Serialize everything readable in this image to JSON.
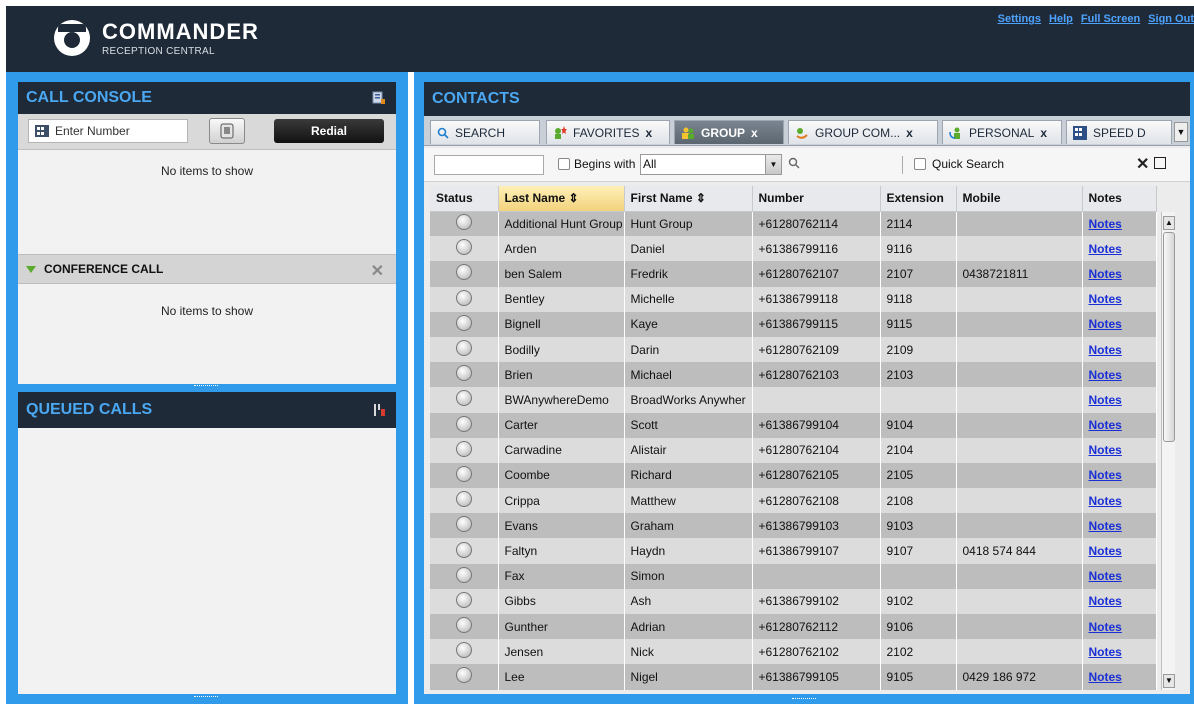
{
  "app": {
    "brand": "COΜΜANDER",
    "subtitle": "RECEPTION CENTRAL"
  },
  "toplinks": [
    "Settings",
    "Help",
    "Full Screen",
    "Sign Out"
  ],
  "call_console": {
    "title": "CALL CONSOLE",
    "number_placeholder": "Enter Number",
    "redial_label": "Redial",
    "empty_text": "No items to show",
    "conference_title": "CONFERENCE CALL",
    "conference_empty_text": "No items to show"
  },
  "queued_calls": {
    "title": "QUEUED CALLS"
  },
  "contacts": {
    "title": "CONTACTS",
    "tabs": [
      {
        "label": "SEARCH",
        "icon": "search-icon",
        "closable": false,
        "active": false
      },
      {
        "label": "FAVORITES",
        "icon": "favorites-star-icon",
        "closable": true,
        "active": false
      },
      {
        "label": "GROUP",
        "icon": "group-people-icon",
        "closable": true,
        "active": true
      },
      {
        "label": "GROUP COM...",
        "icon": "group-common-phone-icon",
        "closable": true,
        "active": false
      },
      {
        "label": "PERSONAL",
        "icon": "personal-contact-icon",
        "closable": true,
        "active": false
      },
      {
        "label": "SPEED D",
        "icon": "speed-dial-icon",
        "closable": false,
        "active": false
      }
    ],
    "tab_close": "x",
    "filter": {
      "begins_with_label": "Begins with",
      "select_value": "All",
      "quick_search_label": "Quick Search"
    },
    "columns": [
      "Status",
      "Last Name",
      "First Name",
      "Number",
      "Extension",
      "Mobile",
      "Notes"
    ],
    "rows": [
      {
        "last": "Additional Hunt Group",
        "first": "Hunt Group",
        "number": "+61280762114",
        "ext": "2114",
        "mobile": "",
        "notes": "Notes"
      },
      {
        "last": "Arden",
        "first": "Daniel",
        "number": "+61386799116",
        "ext": "9116",
        "mobile": "",
        "notes": "Notes"
      },
      {
        "last": "ben Salem",
        "first": "Fredrik",
        "number": "+61280762107",
        "ext": "2107",
        "mobile": "0438721811",
        "notes": "Notes"
      },
      {
        "last": "Bentley",
        "first": "Michelle",
        "number": "+61386799118",
        "ext": "9118",
        "mobile": "",
        "notes": "Notes"
      },
      {
        "last": "Bignell",
        "first": "Kaye",
        "number": "+61386799115",
        "ext": "9115",
        "mobile": "",
        "notes": "Notes"
      },
      {
        "last": "Bodilly",
        "first": "Darin",
        "number": "+61280762109",
        "ext": "2109",
        "mobile": "",
        "notes": "Notes"
      },
      {
        "last": "Brien",
        "first": "Michael",
        "number": "+61280762103",
        "ext": "2103",
        "mobile": "",
        "notes": "Notes"
      },
      {
        "last": "BWAnywhereDemo",
        "first": "BroadWorks Anywher",
        "number": "",
        "ext": "",
        "mobile": "",
        "notes": "Notes"
      },
      {
        "last": "Carter",
        "first": "Scott",
        "number": "+61386799104",
        "ext": "9104",
        "mobile": "",
        "notes": "Notes"
      },
      {
        "last": "Carwadine",
        "first": "Alistair",
        "number": "+61280762104",
        "ext": "2104",
        "mobile": "",
        "notes": "Notes"
      },
      {
        "last": "Coombe",
        "first": "Richard",
        "number": "+61280762105",
        "ext": "2105",
        "mobile": "",
        "notes": "Notes"
      },
      {
        "last": "Crippa",
        "first": "Matthew",
        "number": "+61280762108",
        "ext": "2108",
        "mobile": "",
        "notes": "Notes"
      },
      {
        "last": "Evans",
        "first": "Graham",
        "number": "+61386799103",
        "ext": "9103",
        "mobile": "",
        "notes": "Notes"
      },
      {
        "last": "Faltyn",
        "first": "Haydn",
        "number": "+61386799107",
        "ext": "9107",
        "mobile": "0418 574 844",
        "notes": "Notes"
      },
      {
        "last": "Fax",
        "first": "Simon",
        "number": "",
        "ext": "",
        "mobile": "",
        "notes": "Notes"
      },
      {
        "last": "Gibbs",
        "first": "Ash",
        "number": "+61386799102",
        "ext": "9102",
        "mobile": "",
        "notes": "Notes"
      },
      {
        "last": "Gunther",
        "first": "Adrian",
        "number": "+61280762112",
        "ext": "9106",
        "mobile": "",
        "notes": "Notes"
      },
      {
        "last": "Jensen",
        "first": "Nick",
        "number": "+61280762102",
        "ext": "2102",
        "mobile": "",
        "notes": "Notes"
      },
      {
        "last": "Lee",
        "first": "Nigel",
        "number": "+61386799105",
        "ext": "9105",
        "mobile": "0429 186 972",
        "notes": "Notes"
      }
    ]
  }
}
